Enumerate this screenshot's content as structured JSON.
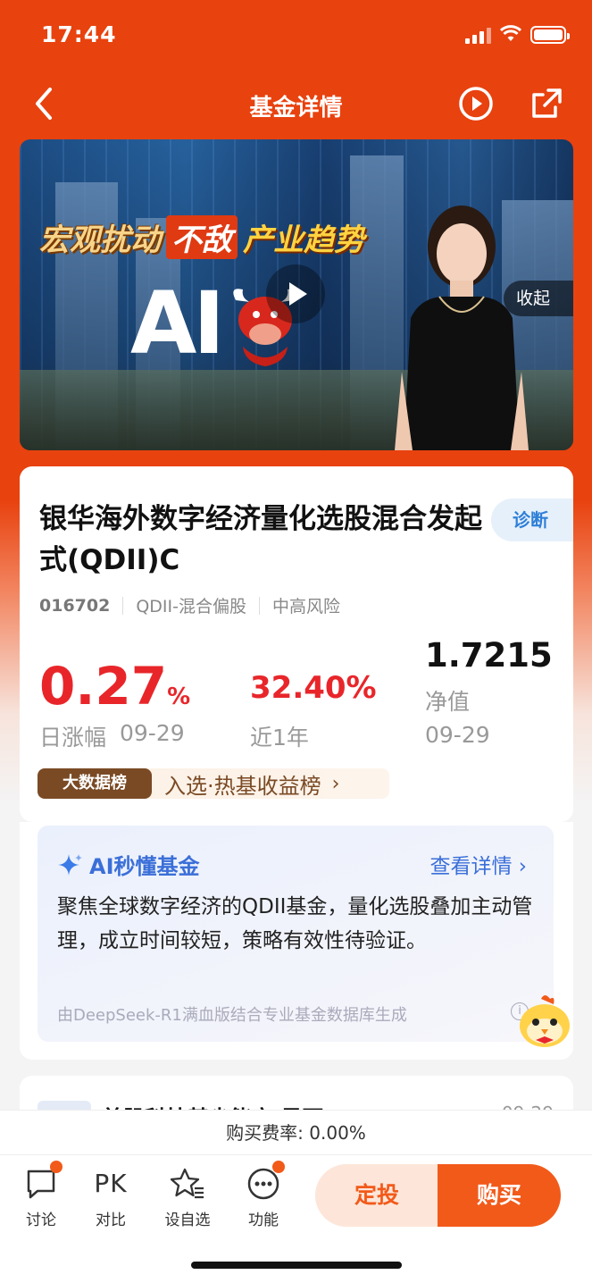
{
  "status_bar": {
    "time": "17:44"
  },
  "nav": {
    "title": "基金详情"
  },
  "video": {
    "headline_1": "宏观扰动",
    "headline_2": "不敌",
    "headline_3": "产业趋势",
    "logo_text": "AI",
    "collapse_label": "收起"
  },
  "fund": {
    "name": "银华海外数字经济量化选股混合发起式(QDII)C",
    "diagnose_label": "诊断",
    "code": "016702",
    "type": "QDII-混合偏股",
    "risk": "中高风险",
    "daily_change": "0.27",
    "daily_change_unit": "%",
    "daily_label": "日涨幅",
    "daily_date": "09-29",
    "year_return": "32.40%",
    "year_label": "近1年",
    "nav_value": "1.7215",
    "nav_label": "净值",
    "nav_date": "09-29",
    "rank_badge": "大数据榜",
    "rank_text": "入选·热基收益榜",
    "accent_red": "#e8262a"
  },
  "ai_summary": {
    "title": "AI秒懂基金",
    "more_label": "查看详情",
    "body": "聚焦全球数字经济的QDII基金，量化选股叠加主动管理，成立时间较短，策略有效性待验证。",
    "footnote": "由DeepSeek-R1满血版结合专业基金数据库生成"
  },
  "next_card": {
    "title": "美股科技基尖能市 是否?",
    "date": "09-29"
  },
  "fee": {
    "text": "购买费率: 0.00%"
  },
  "toolbar": {
    "discuss_label": "讨论",
    "compare_icon_text": "PK",
    "compare_label": "对比",
    "watchlist_label": "设自选",
    "functions_label": "功能",
    "sip_label": "定投",
    "buy_label": "购买",
    "brand_color": "#f25a1a"
  }
}
